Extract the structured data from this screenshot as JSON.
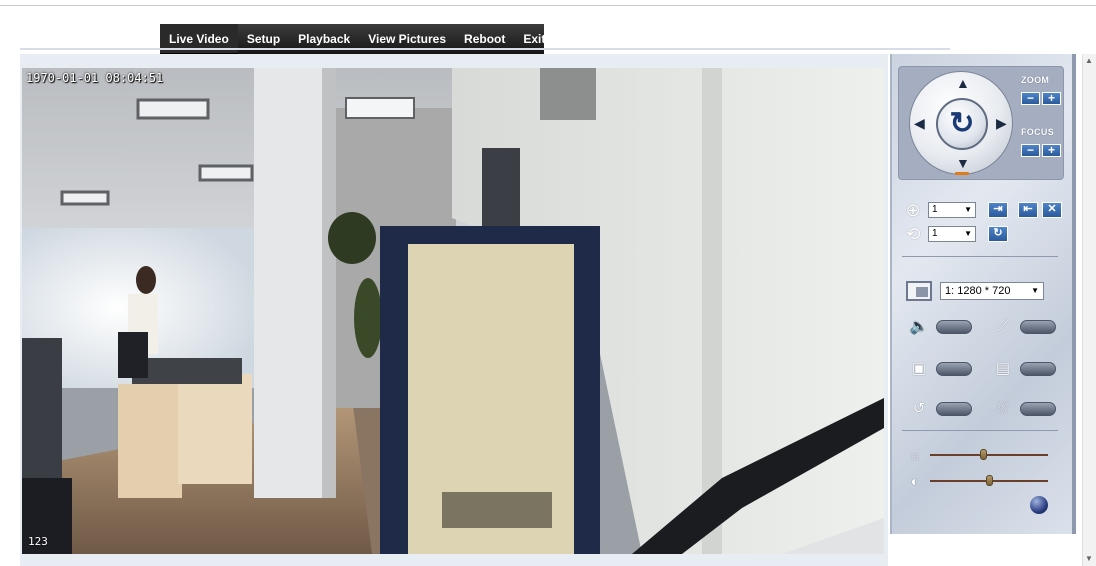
{
  "nav": {
    "items": [
      {
        "label": "Live Video",
        "active": true
      },
      {
        "label": "Setup"
      },
      {
        "label": "Playback"
      },
      {
        "label": "View Pictures"
      },
      {
        "label": "Reboot"
      },
      {
        "label": "Exit"
      }
    ]
  },
  "video": {
    "timestamp": "1970-01-01 08:04:51",
    "channel_label": "123"
  },
  "ptz": {
    "zoom_label": "ZOOM",
    "focus_label": "FOCUS",
    "minus": "−",
    "plus": "+"
  },
  "preset": {
    "preset_value": "1",
    "cruise_value": "1"
  },
  "stream": {
    "resolution": "1: 1280 * 720"
  },
  "sliders": {
    "brightness": 0.45,
    "contrast": 0.5
  },
  "colors": {
    "nav_bg": "#1e1e1e",
    "panel_bg": "#d4dbe6",
    "accent_blue": "#2a5a9c"
  }
}
